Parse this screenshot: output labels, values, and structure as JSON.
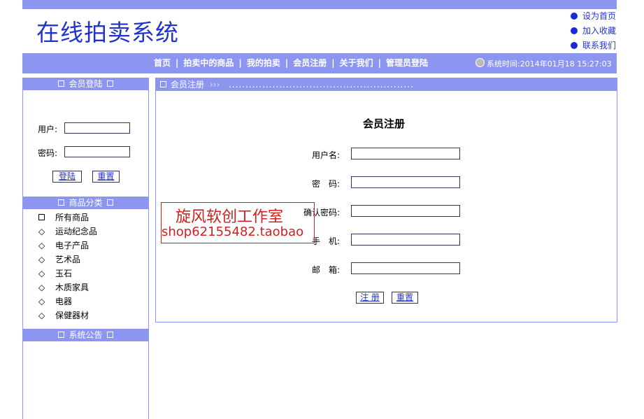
{
  "header": {
    "logo": "在线拍卖系统",
    "quick_links": [
      "设为首页",
      "加入收藏",
      "联系我们"
    ]
  },
  "nav": {
    "items": [
      "首页",
      "拍卖中的商品",
      "我的拍卖",
      "会员注册",
      "关于我们",
      "管理员登陆"
    ],
    "system_time": "系统时间:2014年01月18 15:27:03"
  },
  "sidebar": {
    "login_title": "会员登陆",
    "user_label": "用户:",
    "password_label": "密码:",
    "login_button": "登陆",
    "reset_button": "重置",
    "category_title": "商品分类",
    "categories": [
      "所有商品",
      "运动纪念品",
      "电子产品",
      "艺术品",
      "玉石",
      "木质家具",
      "电器",
      "保健器材"
    ],
    "notice_title": "系统公告"
  },
  "main": {
    "breadcrumb": "会员注册",
    "form_title": "会员注册",
    "fields": [
      {
        "label": "用户名:"
      },
      {
        "label": "密　码:"
      },
      {
        "label": "确认密码:"
      },
      {
        "label": "手　机:"
      },
      {
        "label": "邮　箱:"
      }
    ],
    "submit_button": "注 册",
    "reset_button": "重置"
  },
  "watermark": {
    "line1": "旋风软创工作室",
    "line2": "shop62155482.taobao"
  }
}
